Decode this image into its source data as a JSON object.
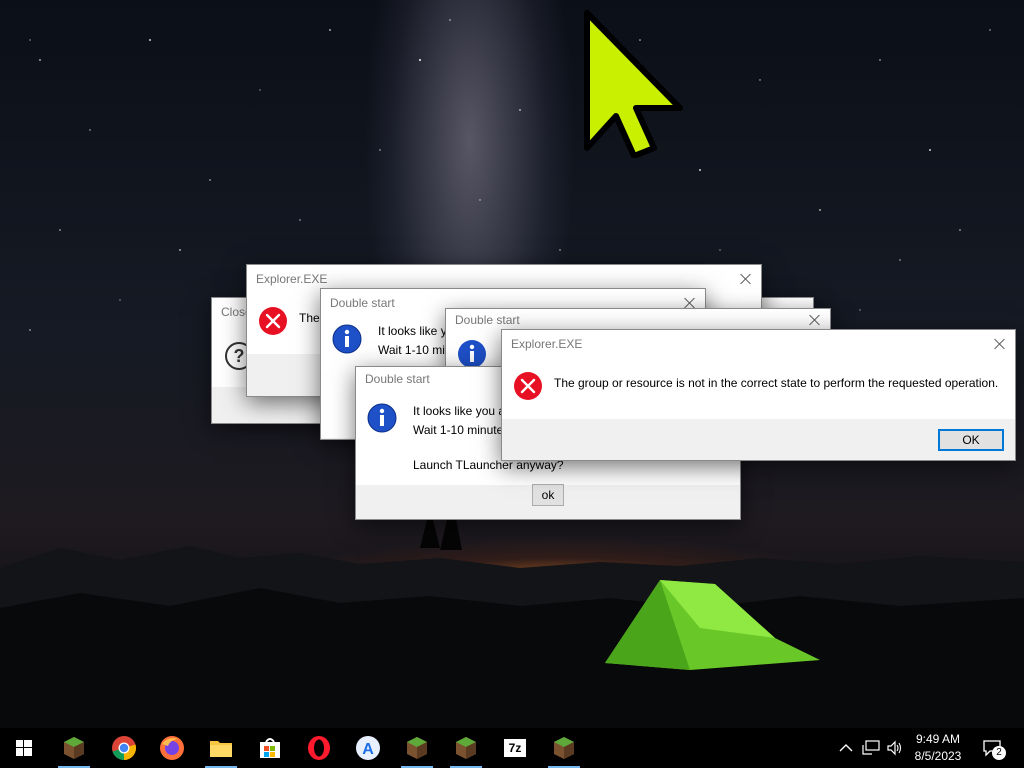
{
  "dialogs": {
    "close_dialog": {
      "title": "Close"
    },
    "explorer_back": {
      "title": "Explorer.EXE",
      "message": "The"
    },
    "double_start_1": {
      "title": "Double start",
      "line1": "It looks like y",
      "line2": "Wait 1-10 mi"
    },
    "double_start_2": {
      "title": "Double start"
    },
    "double_start_3": {
      "title": "Double start",
      "line1": "It looks like you a",
      "line2": "Wait 1-10 minute",
      "line3": "Launch TLauncher anyway?",
      "ok_label": "ok"
    },
    "explorer_front": {
      "title": "Explorer.EXE",
      "message": "The group or resource is not in the correct state to perform the requested operation.",
      "ok_label": "OK"
    }
  },
  "taskbar": {
    "pinned": [
      {
        "name": "start",
        "icon": "windows-logo-icon"
      },
      {
        "name": "minecraft-1",
        "icon": "minecraft-grass-block-icon"
      },
      {
        "name": "chrome",
        "icon": "chrome-icon"
      },
      {
        "name": "firefox",
        "icon": "firefox-icon"
      },
      {
        "name": "file-explorer",
        "icon": "folder-icon"
      },
      {
        "name": "microsoft-store",
        "icon": "store-bag-icon"
      },
      {
        "name": "opera",
        "icon": "opera-icon"
      },
      {
        "name": "app-store-a",
        "icon": "a-circle-icon"
      },
      {
        "name": "minecraft-2",
        "icon": "minecraft-grass-block-icon"
      },
      {
        "name": "minecraft-3",
        "icon": "minecraft-grass-block-icon"
      },
      {
        "name": "7zip",
        "icon": "7z-icon"
      },
      {
        "name": "minecraft-4",
        "icon": "minecraft-grass-block-icon"
      }
    ],
    "seven_zip_label": "7z",
    "clock": {
      "time": "9:49 AM",
      "date": "8/5/2023"
    },
    "notification_count": "2"
  },
  "colors": {
    "cursor": "#c8f000",
    "error_red": "#e81123",
    "info_blue": "#1e50c8",
    "accent": "#0078d7"
  }
}
